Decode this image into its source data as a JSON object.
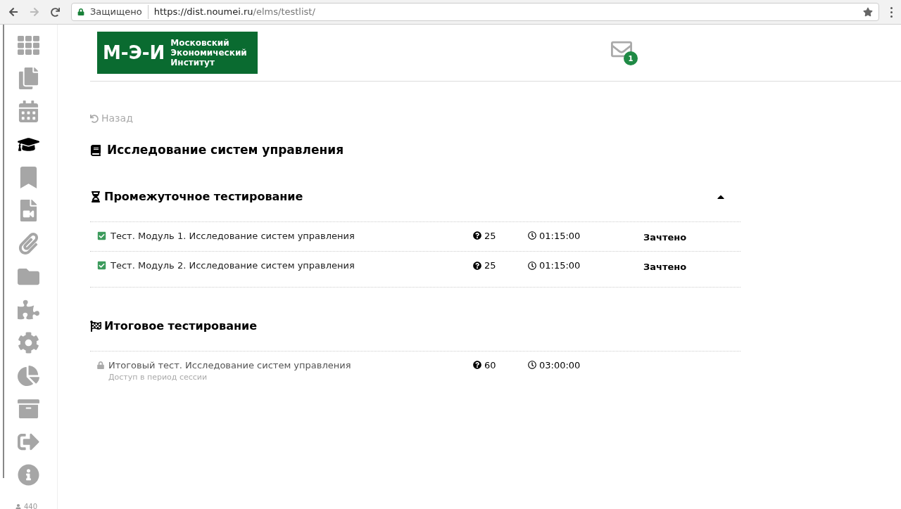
{
  "browser": {
    "secure_label": "Защищено",
    "url_host": "https://dist.noumei.ru",
    "url_path": "/elms/testlist/"
  },
  "sidebar": {
    "items": [
      {
        "selected": false
      },
      {
        "selected": false
      },
      {
        "selected": false
      },
      {
        "selected": true
      },
      {
        "selected": false
      },
      {
        "selected": false
      },
      {
        "selected": false
      },
      {
        "selected": false
      },
      {
        "selected": false
      },
      {
        "selected": false
      },
      {
        "selected": false
      },
      {
        "selected": false
      },
      {
        "selected": false
      },
      {
        "selected": false
      }
    ],
    "user_count": "440"
  },
  "header": {
    "logo": {
      "mark": "М-Э-И",
      "lines": [
        "Московский",
        "Экономический",
        "Институт"
      ]
    },
    "messages_badge": "1"
  },
  "back_link": "Назад",
  "course_title": "Исследование систем управления",
  "sections": [
    {
      "kind": "interim",
      "title": "Промежуточное тестирование",
      "expanded": true,
      "tests": [
        {
          "kind": "passed",
          "name": "Тест. Модуль 1. Исследование систем управления",
          "questions": "25",
          "duration": "01:15:00",
          "status": "Зачтено"
        },
        {
          "kind": "passed",
          "name": "Тест. Модуль 2. Исследование систем управления",
          "questions": "25",
          "duration": "01:15:00",
          "status": "Зачтено"
        }
      ]
    },
    {
      "kind": "final",
      "title": "Итоговое тестирование",
      "tests": [
        {
          "kind": "locked",
          "name": "Итоговый тест. Исследование систем управления",
          "note": "Доступ в период сессии",
          "questions": "60",
          "duration": "03:00:00"
        }
      ]
    }
  ]
}
